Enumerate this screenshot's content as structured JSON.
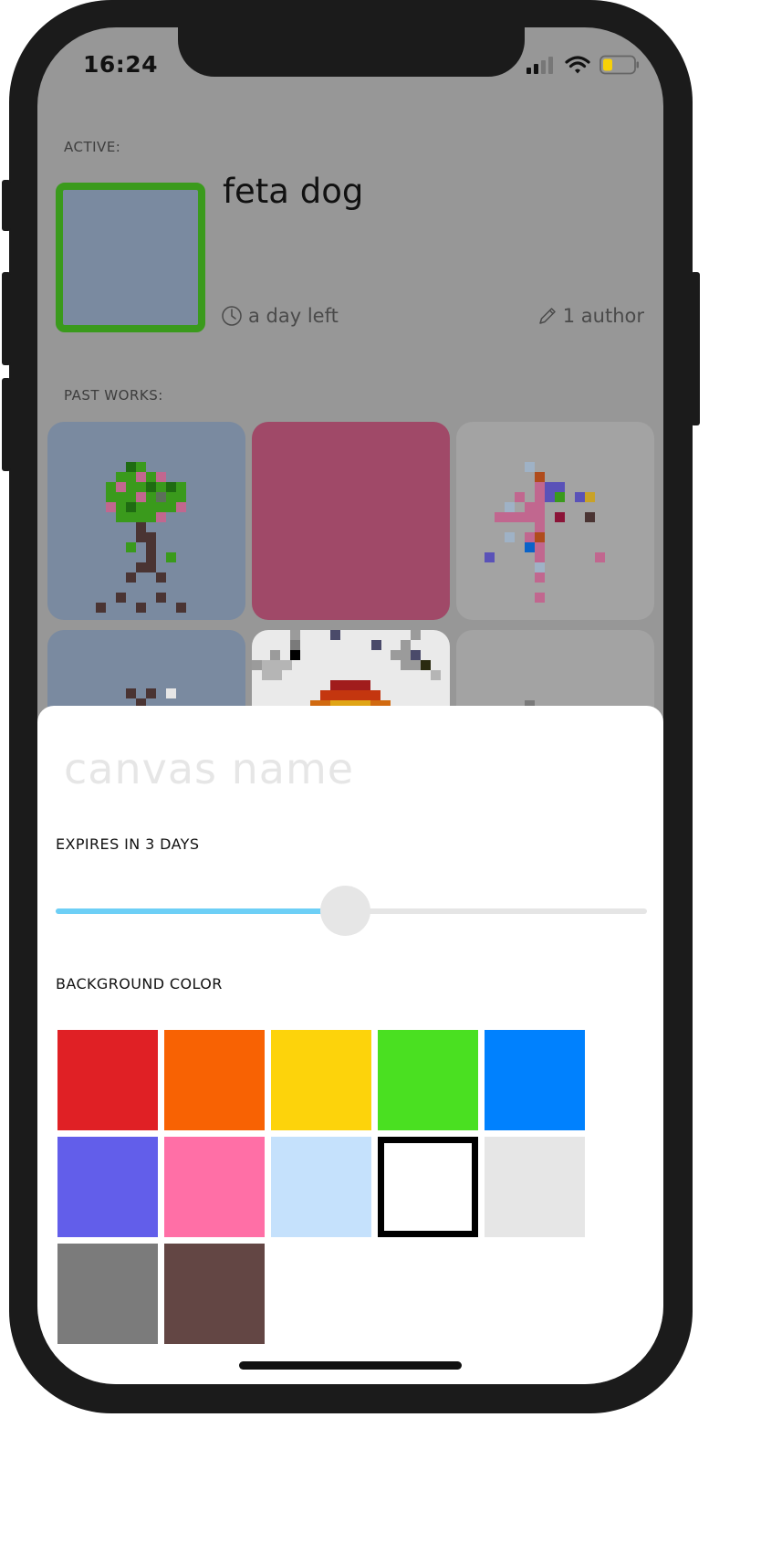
{
  "status_bar": {
    "time": "16:24"
  },
  "active": {
    "section_label": "ACTIVE:",
    "title": "feta dog",
    "time_left": "a day left",
    "authors": "1 author"
  },
  "past_works": {
    "section_label": "PAST WORKS:"
  },
  "sheet": {
    "name_placeholder": "canvas name",
    "expires_label": "EXPIRES IN 3 DAYS",
    "expires_slider_fraction": 0.49,
    "background_label": "BACKGROUND COLOR",
    "colors": [
      "#e02025",
      "#f86203",
      "#fdd30b",
      "#4ae021",
      "#0081fe",
      "#625eea",
      "#ff6fa6",
      "#c5e1fc",
      "#ffffff",
      "#e6e6e6",
      "#7b7b7b",
      "#634644"
    ],
    "selected_color_index": 8
  }
}
